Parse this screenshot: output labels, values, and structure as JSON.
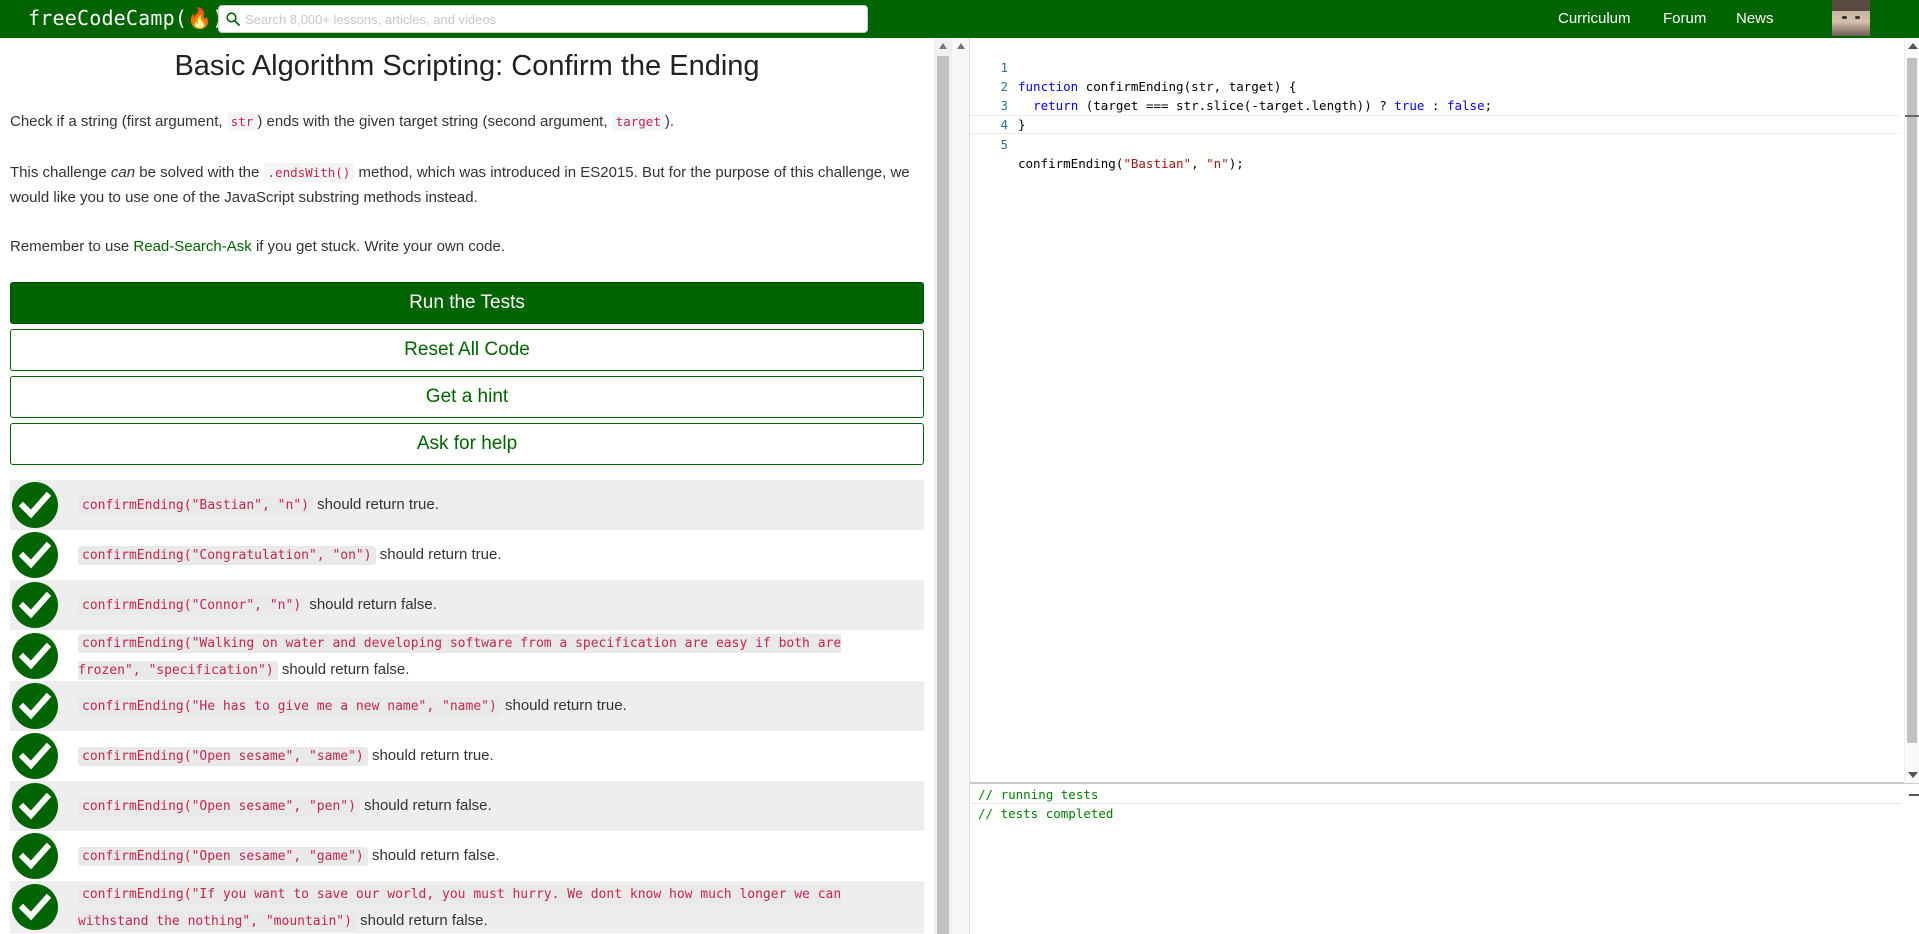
{
  "nav": {
    "logo": "freeCodeCamp(🔥)",
    "search_placeholder": "Search 8,000+ lessons, articles, and videos",
    "links": [
      "Curriculum",
      "Forum",
      "News"
    ]
  },
  "challenge": {
    "title": "Basic Algorithm Scripting: Confirm the Ending",
    "desc1": {
      "pre": "Check if a string (first argument, ",
      "code1": "str",
      "mid": ") ends with the given target string (second argument, ",
      "code2": "target",
      "post": ")."
    },
    "desc2": {
      "pre": "This challenge ",
      "em": "can",
      "mid": " be solved with the ",
      "code": ".endsWith()",
      "post": " method, which was introduced in ES2015. But for the purpose of this challenge, we would like you to use one of the JavaScript substring methods instead."
    },
    "desc3": {
      "pre": "Remember to use ",
      "link": "Read-Search-Ask",
      "post": " if you get stuck. Write your own code."
    }
  },
  "buttons": {
    "run": "Run the Tests",
    "reset": "Reset All Code",
    "hint": "Get a hint",
    "help": "Ask for help"
  },
  "tests": [
    {
      "code": "confirmEnding(\"Bastian\", \"n\")",
      "text": "should return true.",
      "passed": true
    },
    {
      "code": "confirmEnding(\"Congratulation\", \"on\")",
      "text": "should return true.",
      "passed": true
    },
    {
      "code": "confirmEnding(\"Connor\", \"n\")",
      "text": "should return false.",
      "passed": true
    },
    {
      "code": "confirmEnding(\"Walking on water and developing software from a specification are easy if both are frozen\", \"specification\")",
      "text": "should return false.",
      "passed": true
    },
    {
      "code": "confirmEnding(\"He has to give me a new name\", \"name\")",
      "text": "should return true.",
      "passed": true
    },
    {
      "code": "confirmEnding(\"Open sesame\", \"same\")",
      "text": "should return true.",
      "passed": true
    },
    {
      "code": "confirmEnding(\"Open sesame\", \"pen\")",
      "text": "should return false.",
      "passed": true
    },
    {
      "code": "confirmEnding(\"Open sesame\", \"game\")",
      "text": "should return false.",
      "passed": true
    },
    {
      "code": "confirmEnding(\"If you want to save our world, you must hurry. We dont know how much longer we can withstand the nothing\", \"mountain\")",
      "text": "should return false.",
      "passed": true
    }
  ],
  "editor": {
    "lines": [
      {
        "n": "1",
        "text": "function confirmEnding(str, target) {"
      },
      {
        "n": "2",
        "text": "  return (target === str.slice(-target.length)) ? true : false;"
      },
      {
        "n": "3",
        "text": "}"
      },
      {
        "n": "4",
        "text": ""
      },
      {
        "n": "5",
        "text": "confirmEnding(\"Bastian\", \"n\");"
      }
    ]
  },
  "output": {
    "lines": [
      "// running tests",
      "// tests completed"
    ]
  },
  "colors": {
    "brand": "#006400",
    "code_red": "#c7254e",
    "keyword_blue": "#0000ff",
    "string_red": "#a31515",
    "line_number": "#237893",
    "console_green": "#008000"
  },
  "icons": {
    "search": "search-icon",
    "check": "check-circle-icon",
    "avatar": "user-avatar"
  }
}
